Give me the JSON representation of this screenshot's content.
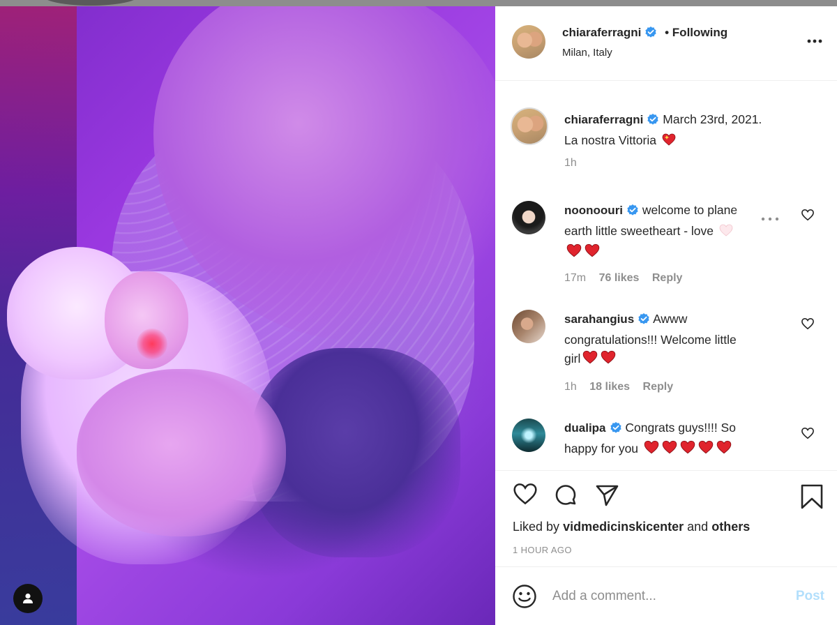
{
  "post": {
    "author": "chiaraferragni",
    "follow_state": "• Following",
    "location": "Milan, Italy",
    "caption_line1": "March 23rd, 2021.",
    "caption_line2": "La nostra Vittoria",
    "caption_time": "1h"
  },
  "comments": [
    {
      "user": "noonoouri",
      "text_line1": "welcome to plane",
      "text_line2": "earth little sweetheart - love",
      "time": "17m",
      "likes": "76 likes",
      "reply": "Reply"
    },
    {
      "user": "sarahangius",
      "text_line1": "Awww",
      "text_line2": "congratulations!!! Welcome little",
      "text_line3": "girl",
      "time": "1h",
      "likes": "18 likes",
      "reply": "Reply"
    },
    {
      "user": "dualipa",
      "text_line1": "Congrats guys!!!! So",
      "text_line2": "happy for you"
    }
  ],
  "likes": {
    "prefix": "Liked by",
    "user": "vidmedicinskicenter",
    "and": "and",
    "others": "others"
  },
  "timestamp": "1 HOUR AGO",
  "composer": {
    "placeholder": "Add a comment...",
    "post_label": "Post"
  },
  "colors": {
    "verified_blue": "#3897f0",
    "post_disabled": "#b2dffc",
    "heart_red": "#e0242d"
  },
  "icons": [
    "verified-icon",
    "more-options-icon",
    "heart-outline-icon",
    "comment-icon",
    "share-icon",
    "bookmark-icon",
    "smiley-icon",
    "user-tag-icon",
    "red-heart-emoji"
  ]
}
